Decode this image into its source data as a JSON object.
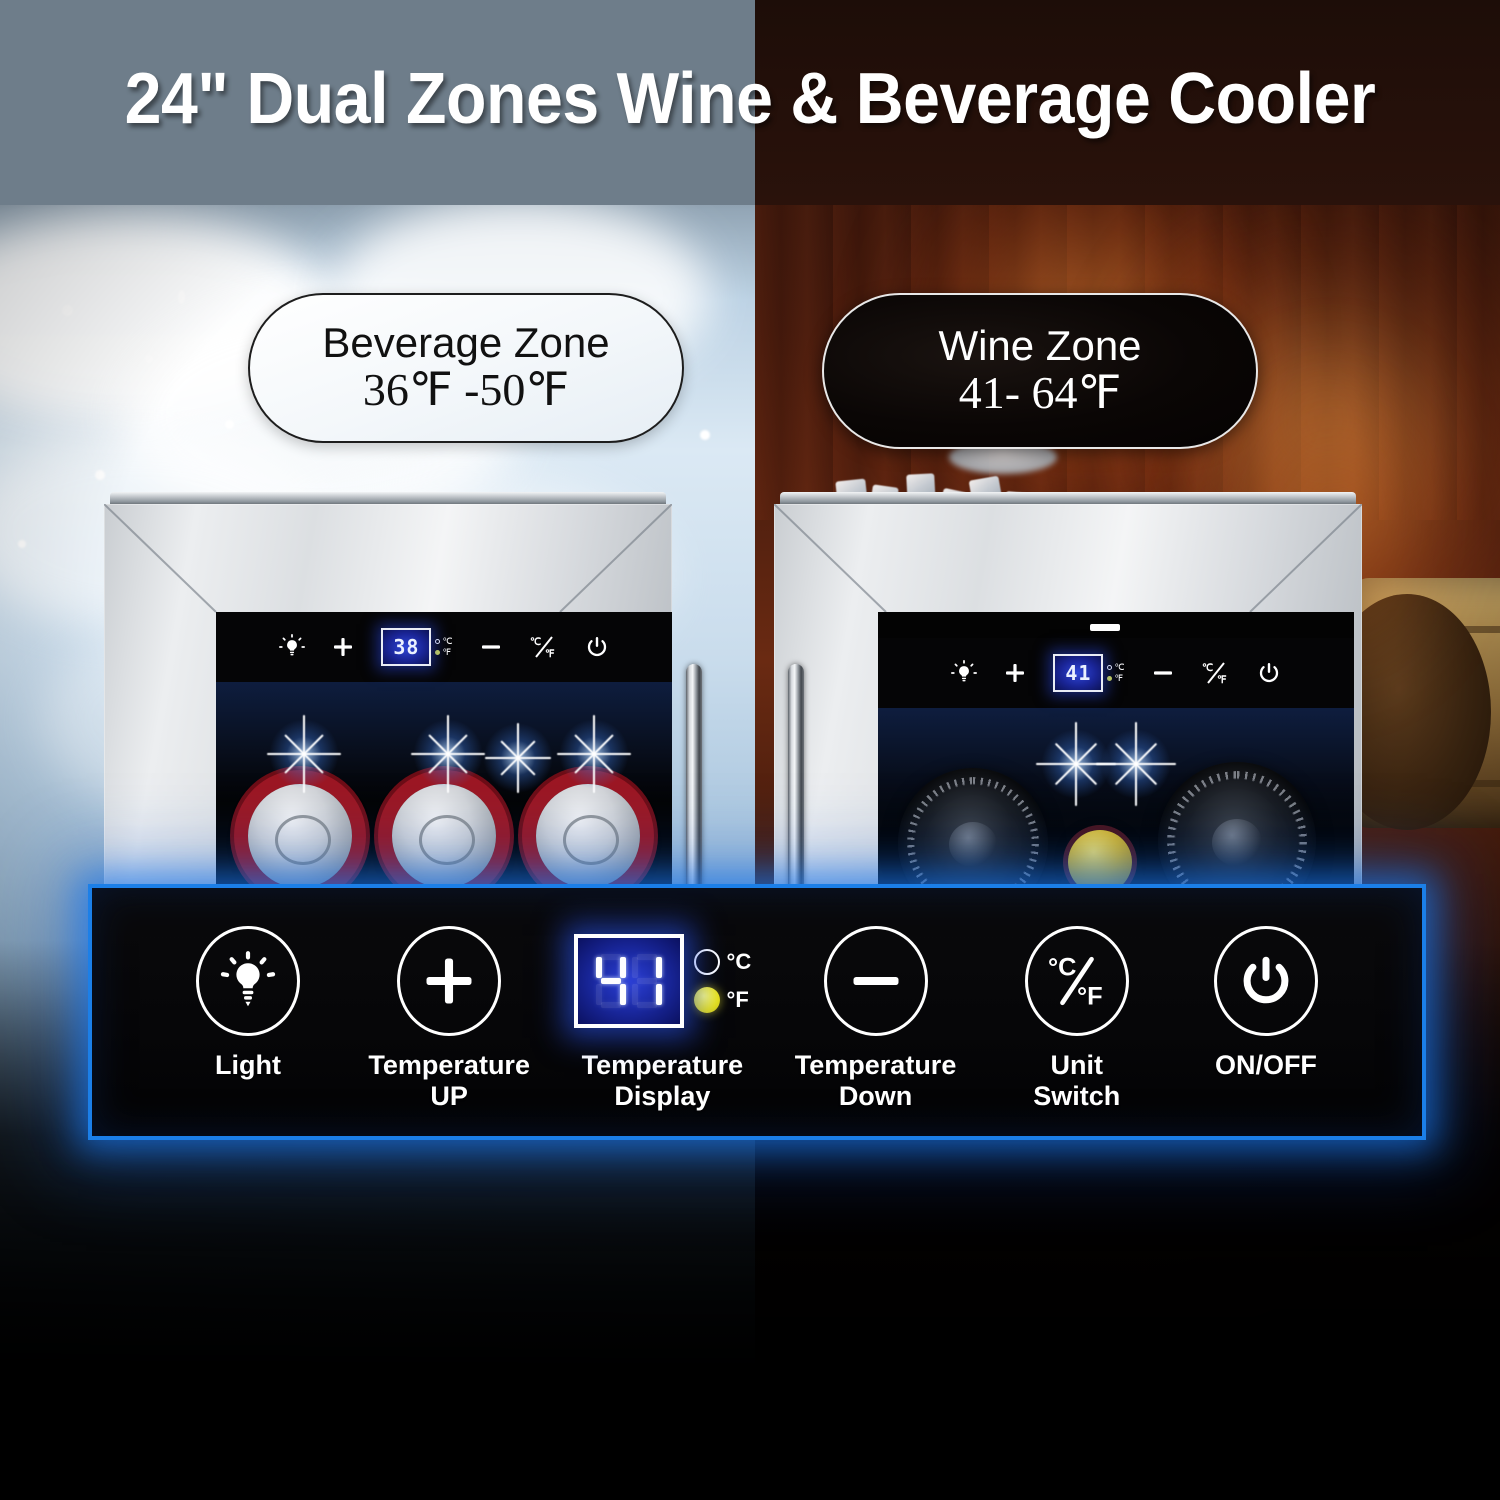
{
  "header": {
    "title": "24\" Dual Zones Wine & Beverage Cooler"
  },
  "zones": [
    {
      "id": "beverage",
      "name": "Beverage Zone",
      "range": "36℉ -50℉",
      "display_value": "38",
      "unit_c_label": "℃",
      "unit_f_label": "℉"
    },
    {
      "id": "wine",
      "name": "Wine Zone",
      "range": "41- 64℉",
      "display_value": "41",
      "unit_c_label": "℃",
      "unit_f_label": "℉"
    }
  ],
  "control_panel": {
    "display_value": "41",
    "unit_c_label": "°C",
    "unit_f_label": "°F",
    "active_unit": "F",
    "accent_color": "#1b7fe8",
    "led_color": "#2b3fd6",
    "indicator_on_color": "#e9e31c",
    "controls": [
      {
        "icon": "light-bulb-icon",
        "label": "Light"
      },
      {
        "icon": "plus-icon",
        "label": "Temperature\nUP",
        "line1": "Temperature",
        "line2": "UP"
      },
      {
        "icon": "seven-segment-display-icon",
        "label": "Temperature\nDisplay",
        "line1": "Temperature",
        "line2": "Display"
      },
      {
        "icon": "minus-icon",
        "label": "Temperature\nDown",
        "line1": "Temperature",
        "line2": "Down"
      },
      {
        "icon": "celsius-fahrenheit-icon",
        "label": "Unit\nSwitch",
        "line1": "Unit",
        "line2": "Switch"
      },
      {
        "icon": "power-icon",
        "label": "ON/OFF",
        "line1": "ON/OFF",
        "line2": ""
      }
    ]
  }
}
